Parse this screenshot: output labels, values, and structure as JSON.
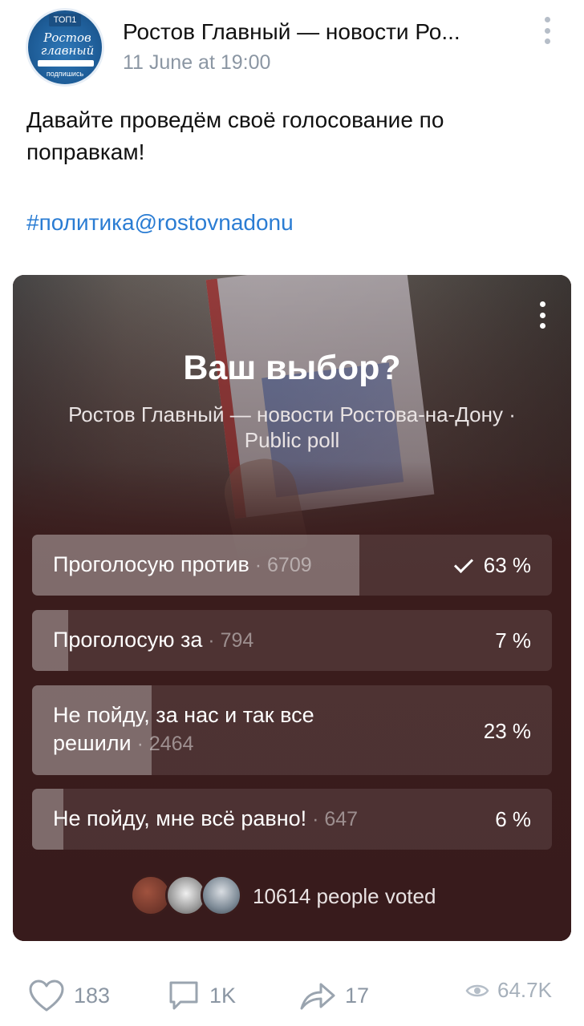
{
  "post": {
    "group_name": "Ростов Главный — новости Ро...",
    "date": "11 June at 19:00",
    "text": "Давайте проведём своё голосование по поправкам!",
    "hashtag": "#политика@rostovnadonu"
  },
  "avatar": {
    "top_label": "ТОП1",
    "logo_line1": "Ростов",
    "logo_line2": "главный",
    "subscribe_label": "подпишись"
  },
  "poll": {
    "title": "Ваш выбор?",
    "subtitle": "Ростов Главный — новости Ростова-на-Дону · Public poll",
    "options": [
      {
        "label": "Проголосую против",
        "count": "6709",
        "percent": "63 %",
        "fraction": 0.63,
        "selected": true
      },
      {
        "label": "Проголосую за",
        "count": "794",
        "percent": "7 %",
        "fraction": 0.07,
        "selected": false
      },
      {
        "label": "Не пойду, за нас и так все решили",
        "count": "2464",
        "percent": "23 %",
        "fraction": 0.23,
        "selected": false
      },
      {
        "label": "Не пойду, мне всё равно!",
        "count": "647",
        "percent": "6 %",
        "fraction": 0.06,
        "selected": false
      }
    ],
    "voted_text": "10614 people voted"
  },
  "footer": {
    "likes": "183",
    "comments": "1K",
    "shares": "17",
    "views": "64.7K"
  },
  "colors": {
    "accent": "#2a7cd3",
    "muted": "#8b96a3",
    "poll_bg": "#3a1c1c"
  },
  "icons": [
    "more-vertical-icon",
    "heart-icon",
    "comment-icon",
    "share-icon",
    "eye-icon",
    "checkmark-icon"
  ]
}
